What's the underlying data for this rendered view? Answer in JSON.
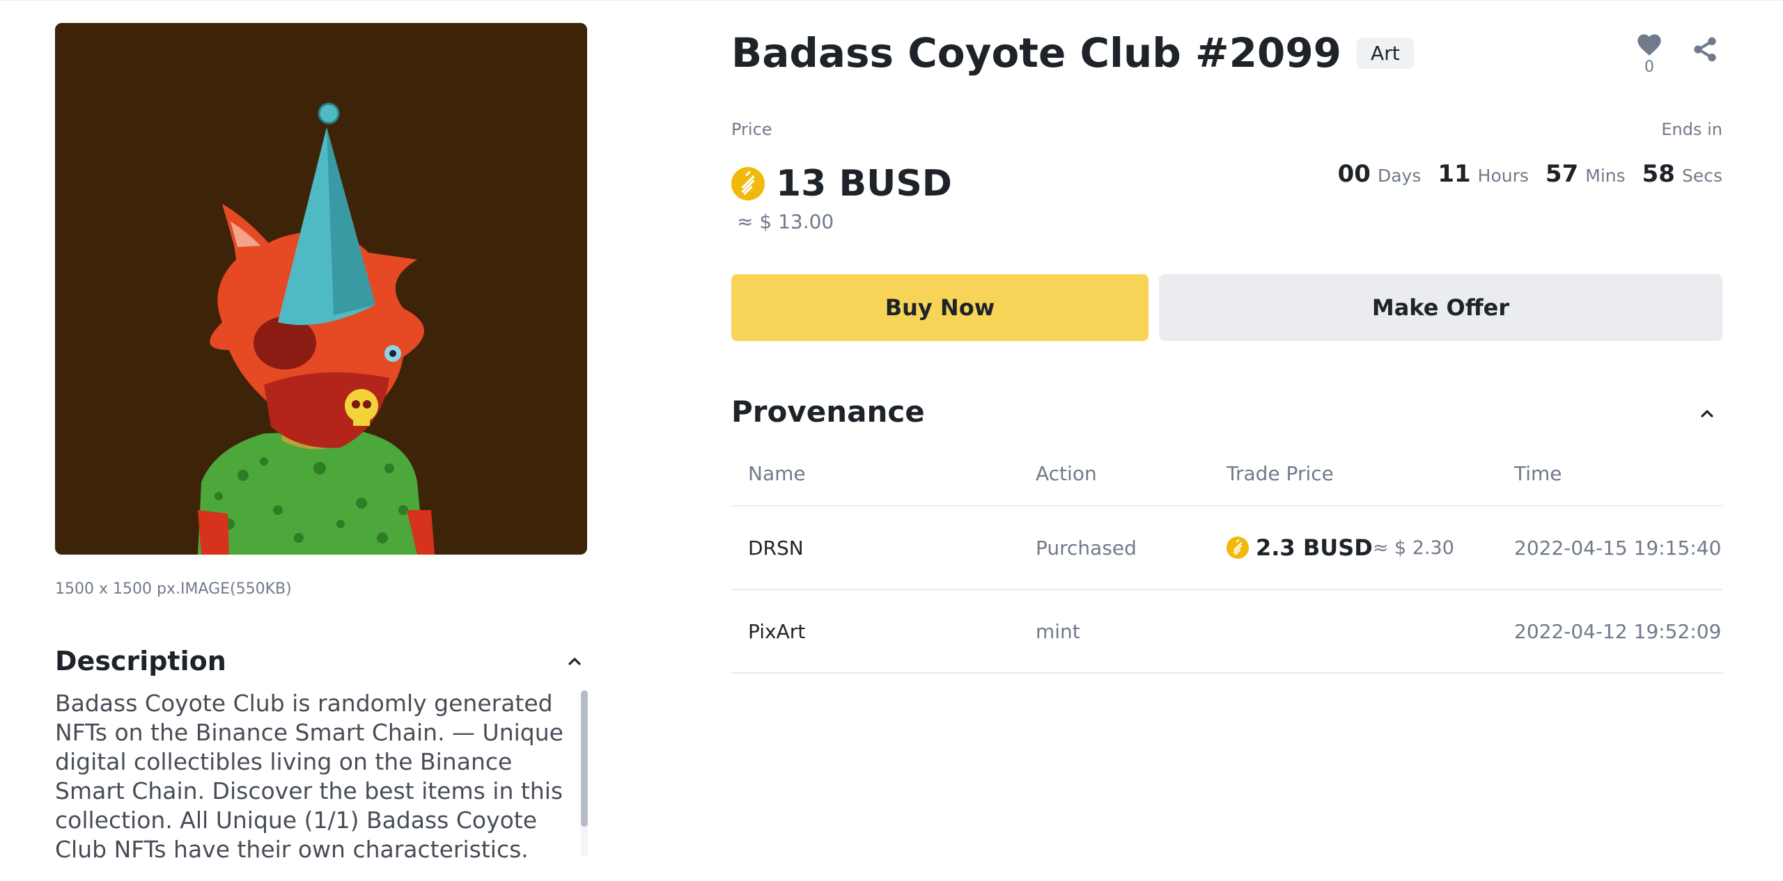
{
  "image": {
    "meta": "1500 x 1500 px.IMAGE(550KB)"
  },
  "description": {
    "title": "Description",
    "text": "Badass Coyote Club is randomly generated NFTs on the Binance Smart Chain. — Unique digital collectibles living on the Binance Smart Chain. Discover the best items in this collection. All Unique (1/1) Badass Coyote Club NFTs have their own characteristics. Join the journey of Crypto with one"
  },
  "header": {
    "title": "Badass Coyote Club #2099",
    "tag": "Art",
    "favorites": "0"
  },
  "price": {
    "label": "Price",
    "value": "13 BUSD",
    "usd": "≈ $ 13.00",
    "ends_label": "Ends in"
  },
  "countdown": {
    "days": "00",
    "days_label": "Days",
    "hours": "11",
    "hours_label": "Hours",
    "mins": "57",
    "mins_label": "Mins",
    "secs": "58",
    "secs_label": "Secs"
  },
  "buttons": {
    "buy": "Buy Now",
    "offer": "Make Offer"
  },
  "provenance": {
    "title": "Provenance",
    "columns": [
      "Name",
      "Action",
      "Trade Price",
      "Time"
    ],
    "rows": [
      {
        "name": "DRSN",
        "action": "Purchased",
        "price": "2.3 BUSD",
        "usd": "≈ $ 2.30",
        "time": "2022-04-15 19:15:40"
      },
      {
        "name": "PixArt",
        "action": "mint",
        "price": "",
        "usd": "",
        "time": "2022-04-12 19:52:09"
      }
    ]
  },
  "colors": {
    "accent": "#F7D458",
    "coin": "#F0B90B",
    "text": "#1E2329",
    "muted": "#707A8A"
  },
  "icons": {
    "favorite": "heart-icon",
    "share": "share-icon",
    "collapse": "chevron-up-icon",
    "token": "busd-coin-icon"
  }
}
